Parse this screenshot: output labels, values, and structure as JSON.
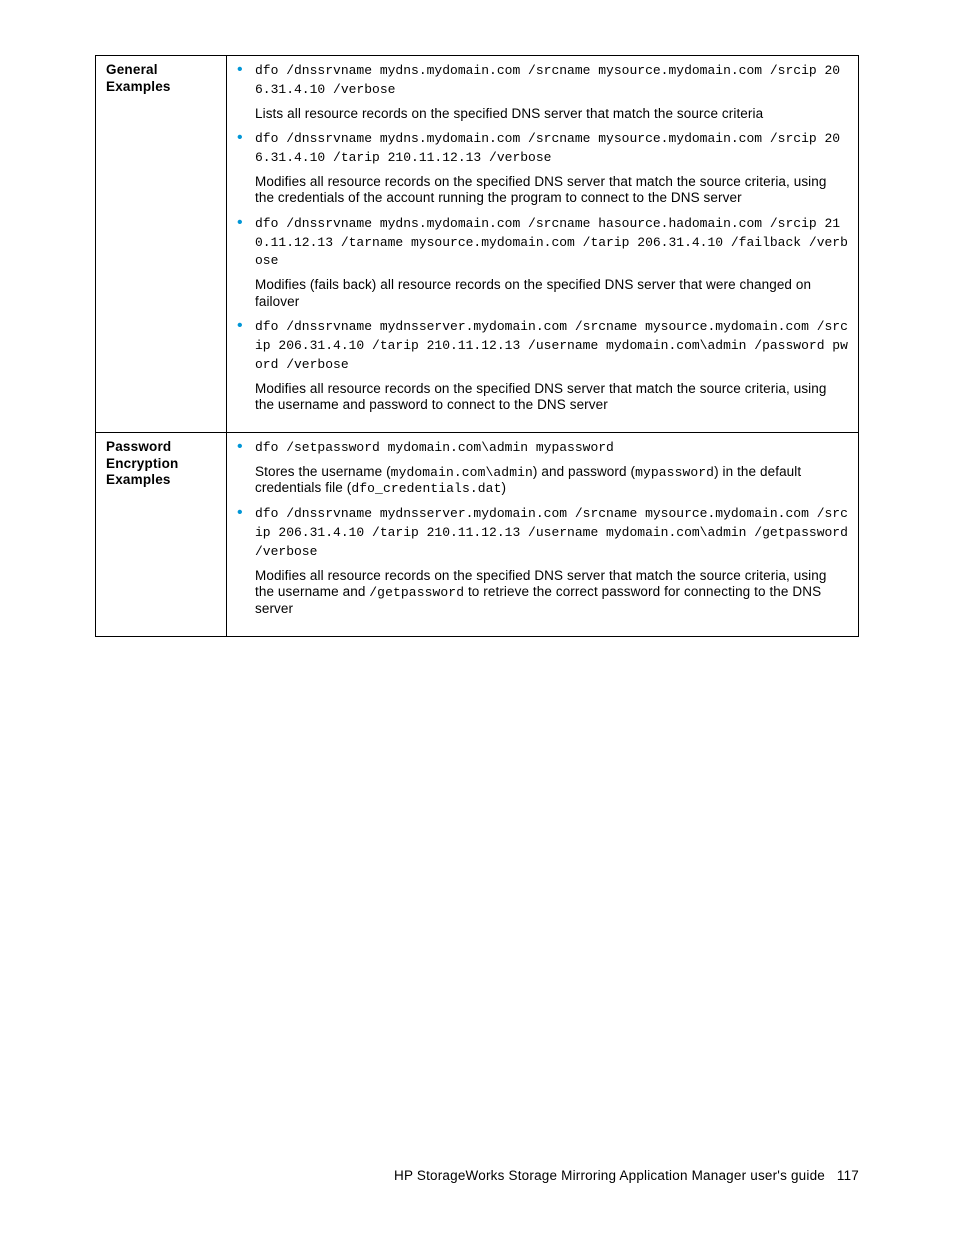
{
  "rows": [
    {
      "label": "General Examples",
      "items": [
        {
          "code": "dfo /dnssrvname mydns.mydomain.com /srcname mysource.mydomain.com /srcip 206.31.4.10 /verbose",
          "desc_parts": [
            {
              "t": "text",
              "v": "Lists all resource records on the specified DNS server that match the source criteria"
            }
          ]
        },
        {
          "code": "dfo /dnssrvname mydns.mydomain.com /srcname mysource.mydomain.com /srcip 206.31.4.10 /tarip 210.11.12.13 /verbose",
          "desc_parts": [
            {
              "t": "text",
              "v": "Modifies all resource records on the specified DNS server that match the source criteria, using the credentials of the account running the program to connect to the DNS server"
            }
          ]
        },
        {
          "code": "dfo /dnssrvname mydns.mydomain.com /srcname hasource.hadomain.com /srcip 210.11.12.13 /tarname mysource.mydomain.com /tarip 206.31.4.10 /failback /verbose",
          "desc_parts": [
            {
              "t": "text",
              "v": "Modifies (fails back) all resource records on the specified DNS server that were changed on failover"
            }
          ]
        },
        {
          "code": "dfo /dnssrvname mydnsserver.mydomain.com /srcname mysource.mydomain.com /srcip 206.31.4.10 /tarip 210.11.12.13 /username mydomain.com\\admin /password pword /verbose",
          "desc_parts": [
            {
              "t": "text",
              "v": "Modifies all resource records on the specified DNS server that match the source criteria, using the username and password to connect to the DNS server"
            }
          ]
        }
      ]
    },
    {
      "label": "Password Encryption Examples",
      "items": [
        {
          "code": "dfo /setpassword mydomain.com\\admin mypassword",
          "desc_parts": [
            {
              "t": "text",
              "v": "Stores the username ("
            },
            {
              "t": "code",
              "v": "mydomain.com\\admin"
            },
            {
              "t": "text",
              "v": ") and password ("
            },
            {
              "t": "code",
              "v": "mypassword"
            },
            {
              "t": "text",
              "v": ") in the default credentials file ("
            },
            {
              "t": "code",
              "v": "dfo_credentials.dat"
            },
            {
              "t": "text",
              "v": ")"
            }
          ]
        },
        {
          "code": "dfo /dnssrvname mydnsserver.mydomain.com /srcname mysource.mydomain.com /srcip 206.31.4.10 /tarip 210.11.12.13 /username mydomain.com\\admin /getpassword /verbose",
          "desc_parts": [
            {
              "t": "text",
              "v": "Modifies all resource records on the specified DNS server that match the source criteria, using the username and "
            },
            {
              "t": "code",
              "v": "/getpassword"
            },
            {
              "t": "text",
              "v": " to retrieve the correct password for connecting to the DNS server"
            }
          ]
        }
      ]
    }
  ],
  "footer": {
    "text": "HP StorageWorks Storage Mirroring Application Manager user's guide",
    "page": "117"
  }
}
